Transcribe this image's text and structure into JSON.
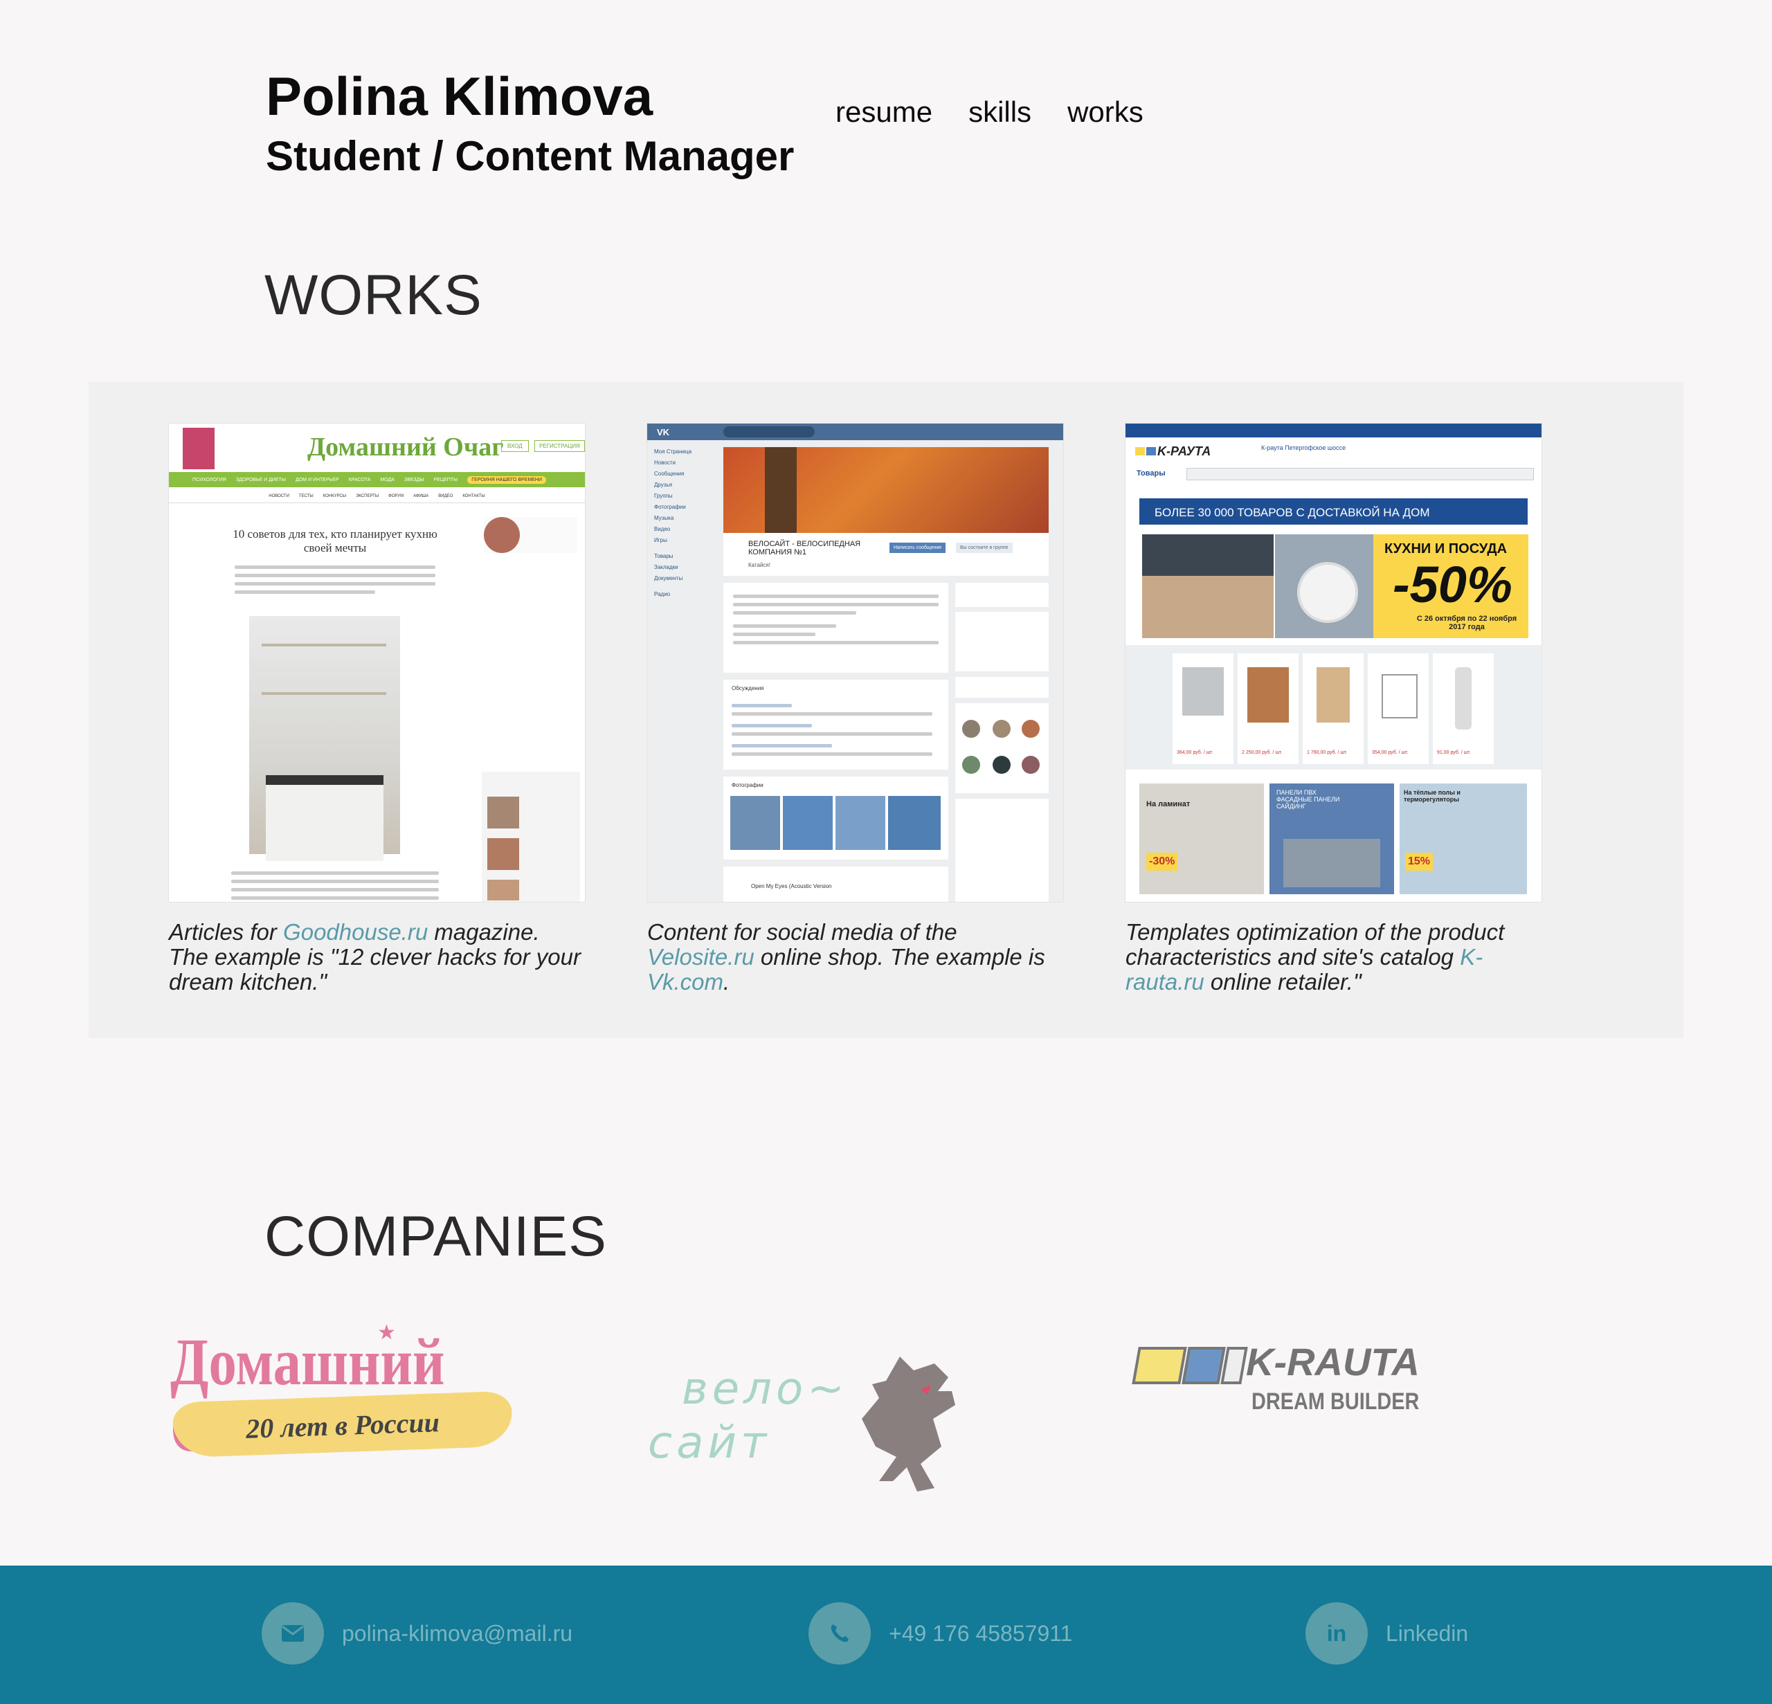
{
  "header": {
    "name": "Polina Klimova",
    "role": "Student / Content Manager"
  },
  "nav": [
    {
      "label": "resume"
    },
    {
      "label": "skills"
    },
    {
      "label": "works"
    }
  ],
  "works": {
    "title": "WORKS",
    "items": [
      {
        "pre": "Articles for ",
        "link": "Goodhouse.ru",
        "post": " magazine. The example is \"12 clever hacks for your dream kitchen.\"",
        "screenshot": {
          "logo": "Домашний Очаг",
          "article_title": "10 советов для тех, кто планирует кухню своей мечты",
          "menu": [
            "ПСИХОЛОГИЯ",
            "ЗДОРОВЬЕ И ДИЕТЫ",
            "ДОМ И ИНТЕРЬЕР",
            "КРАСОТА",
            "МОДА",
            "ЗВЕЗДЫ",
            "РЕЦЕПТЫ"
          ],
          "submenu": [
            "НОВОСТИ",
            "ТЕСТЫ",
            "КОНКУРСЫ",
            "ЭКСПЕРТЫ",
            "ФОРУМ",
            "АФИША",
            "ВИДЕО",
            "КОНТАКТЫ"
          ],
          "login": "ВХОД",
          "register": "РЕГИСТРАЦИЯ",
          "heroine": "ГЕРОИНЯ НАШЕГО ВРЕМЕНИ"
        }
      },
      {
        "pre": "Content for social media of the ",
        "link": "Velosite.ru",
        "mid": " online shop. The example is ",
        "link2": "Vk.com",
        "post": ".",
        "screenshot": {
          "group_name": "ВЕЛОСАЙТ - ВЕЛОСИПЕДНАЯ КОМПАНИЯ №1",
          "status": "Катайся!",
          "write_btn": "Написать сообщение",
          "join_btn": "Вы состоите в группе",
          "side_menu": [
            "Моя Страница",
            "Новости",
            "Сообщения",
            "Друзья",
            "Группы",
            "Фотографии",
            "Музыка",
            "Видео",
            "Игры",
            "Товары",
            "Закладки",
            "Документы",
            "Радио"
          ],
          "discussions": "Обсуждения",
          "photos": "Фотографии",
          "audio": "Open My Eyes (Acoustic Version"
        }
      },
      {
        "pre": "Templates optimization of the product characteristics and site's catalog ",
        "link": "K-rauta.ru",
        "post": " online retailer.\"",
        "screenshot": {
          "banner": "БОЛЕЕ 30 000 ТОВАРОВ С ДОСТАВКОЙ НА ДОМ",
          "promo_title": "КУХНИ И ПОСУДА",
          "promo_discount": "-50%",
          "promo_dates": "С 26 октября по 22 ноября 2017 года",
          "catalog": "Товары",
          "store": "К-раута Петергофское шоссе",
          "tiles": [
            "На ламинат",
            "ПАНЕЛИ ПВХ ФАСАДНЫЕ ПАНЕЛИ САЙДИНГ",
            "На тёплые полы и терморегуляторы"
          ],
          "discounts": [
            "-30%",
            "15%"
          ],
          "prices": [
            "364,00 руб. / шт.",
            "2 250,00 руб. / шт.",
            "1 760,00 руб. / шт.",
            "354,00 руб. / шт.",
            "91,00 руб. / шт."
          ]
        }
      }
    ]
  },
  "companies": {
    "title": "COMPANIES",
    "logos": [
      {
        "text": "Домашний Очаг",
        "sub": "20 лет в России"
      },
      {
        "line1": "вело~",
        "line2": "сайт"
      },
      {
        "text": "K-RAUTA",
        "sub": "DREAM BUILDER"
      }
    ]
  },
  "footer": {
    "email": "polina-klimova@mail.ru",
    "phone": "+49 176 45857911",
    "linkedin": "Linkedin"
  },
  "colors": {
    "background": "#f9f6f7",
    "band": "#f0f0f0",
    "link": "#5a9aa8",
    "footer": "#137a97",
    "footer_circle": "#5a9ea9",
    "footer_text": "#79b6c2",
    "goodhouse_green": "#8bbf3f",
    "vk_blue": "#4a6d95",
    "krauta_blue": "#1e4f95",
    "krauta_yellow": "#fbd64b"
  }
}
